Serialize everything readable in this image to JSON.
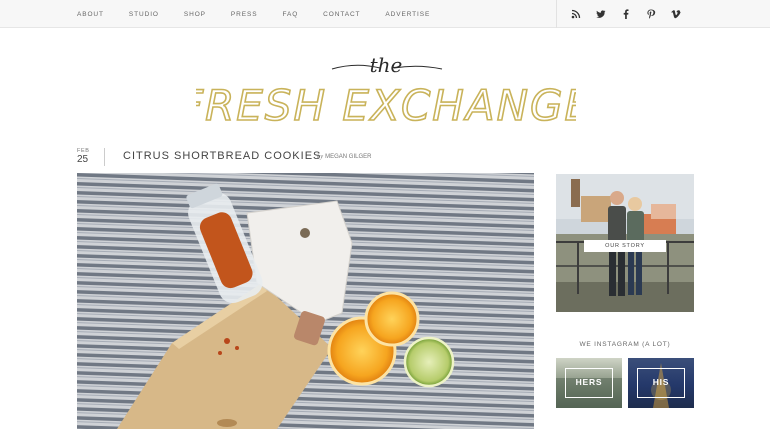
{
  "nav": {
    "items": [
      "ABOUT",
      "STUDIO",
      "SHOP",
      "PRESS",
      "FAQ",
      "CONTACT",
      "ADVERTISE"
    ]
  },
  "social": {
    "icons": [
      "rss-icon",
      "twitter-icon",
      "facebook-icon",
      "pinterest-icon",
      "vimeo-icon"
    ]
  },
  "logo": {
    "script_word": "the",
    "title": "FRESH EXCHANGE",
    "color": "#c9b35a"
  },
  "post": {
    "month": "FEB",
    "day": "25",
    "title": "CITRUS SHORTBREAD COOKIES",
    "by": "by",
    "author": "MEGAN GILGER"
  },
  "sidebar": {
    "about_button": "OUR STORY",
    "instagram_title": "WE INSTAGRAM (A LOT)",
    "tiles": [
      "HERS",
      "HIS"
    ]
  }
}
